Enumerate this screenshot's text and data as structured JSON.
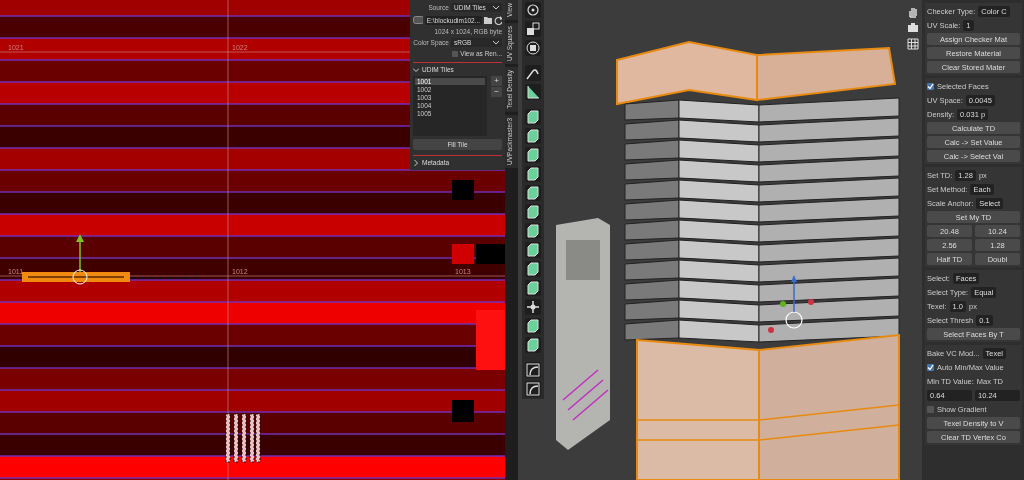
{
  "uv_editor": {
    "tile_labels": [
      "1021",
      "1022",
      "1011",
      "1012",
      "1013"
    ]
  },
  "image_popup": {
    "source_label": "Source",
    "source": "UDIM Tiles",
    "file_path": "E:\\blockudim102...",
    "info": "1024 x 1024,  RGB byte",
    "color_space_label": "Color Space",
    "color_space": "sRGB",
    "view_as_render": {
      "label": "View as Ren...",
      "checked": false
    }
  },
  "udim_panel": {
    "title": "UDIM Tiles",
    "expanded": true,
    "tiles": [
      {
        "label": "1001",
        "selected": true
      },
      {
        "label": "1002",
        "selected": false
      },
      {
        "label": "1003",
        "selected": false
      },
      {
        "label": "1004",
        "selected": false
      },
      {
        "label": "1005",
        "selected": false
      }
    ],
    "add_button": "+",
    "remove_button": "−",
    "fill_button": "Fill Tile"
  },
  "metadata_panel": {
    "title": "Metadata",
    "expanded": false
  },
  "sidebar_tabs": [
    "View",
    "UV Squares",
    "Texel Density",
    "UVPackmaster3"
  ],
  "texel_panel": {
    "sections": [
      {
        "rows": [
          {
            "kind": "field",
            "label": "Checker Type:",
            "value": "Color C"
          },
          {
            "kind": "field",
            "label": "UV Scale:",
            "value": "1"
          },
          {
            "kind": "button",
            "label": "Assign Checker Mat"
          },
          {
            "kind": "button",
            "label": "Restore Material"
          },
          {
            "kind": "button",
            "label": "Clear Stored Mater"
          }
        ]
      },
      {
        "rows": [
          {
            "kind": "checkbox",
            "label": "Selected Faces",
            "checked": true
          },
          {
            "kind": "field",
            "label": "UV Space:",
            "value": "0.0045"
          },
          {
            "kind": "field",
            "label": "Density:",
            "value": "0.031 p"
          },
          {
            "kind": "button",
            "label": "Calculate TD"
          },
          {
            "kind": "button",
            "label": "Calc -> Set Value"
          },
          {
            "kind": "button",
            "label": "Calc -> Select Val"
          }
        ]
      },
      {
        "rows": [
          {
            "kind": "field",
            "label": "Set TD:",
            "value": "1.28",
            "unit": "px"
          },
          {
            "kind": "field",
            "label": "Set Method:",
            "value": "Each"
          },
          {
            "kind": "field",
            "label": "Scale Anchor:",
            "value": "Select"
          },
          {
            "kind": "button",
            "label": "Set My TD"
          },
          {
            "kind": "buttons",
            "labels": [
              "20.48",
              "10.24"
            ]
          },
          {
            "kind": "buttons",
            "labels": [
              "2.56",
              "1.28"
            ]
          },
          {
            "kind": "buttons",
            "labels": [
              "Half TD",
              "Doubl"
            ]
          }
        ]
      },
      {
        "rows": [
          {
            "kind": "field",
            "label": "Select:",
            "value": "Faces"
          },
          {
            "kind": "field",
            "label": "Select Type:",
            "value": "Equal"
          },
          {
            "kind": "field",
            "label": "Texel:",
            "value": "1.0",
            "unit": "px"
          },
          {
            "kind": "field",
            "label": "Select Thresh",
            "value": "0.1"
          },
          {
            "kind": "button",
            "label": "Select Faces By T"
          }
        ]
      },
      {
        "rows": [
          {
            "kind": "field",
            "label": "Bake VC Mod...",
            "value": "Texel"
          },
          {
            "kind": "checkbox",
            "label": "Auto Min/Max Value",
            "checked": true
          },
          {
            "kind": "labels",
            "labels": [
              "Min TD Value:",
              "Max TD"
            ]
          },
          {
            "kind": "values",
            "values": [
              "0.64",
              "10.24"
            ]
          },
          {
            "kind": "checkbox",
            "label": "Show Gradient",
            "checked": false
          },
          {
            "kind": "button",
            "label": "Texel Density to V"
          },
          {
            "kind": "button",
            "label": "Clear TD Vertex Co"
          }
        ]
      }
    ]
  }
}
